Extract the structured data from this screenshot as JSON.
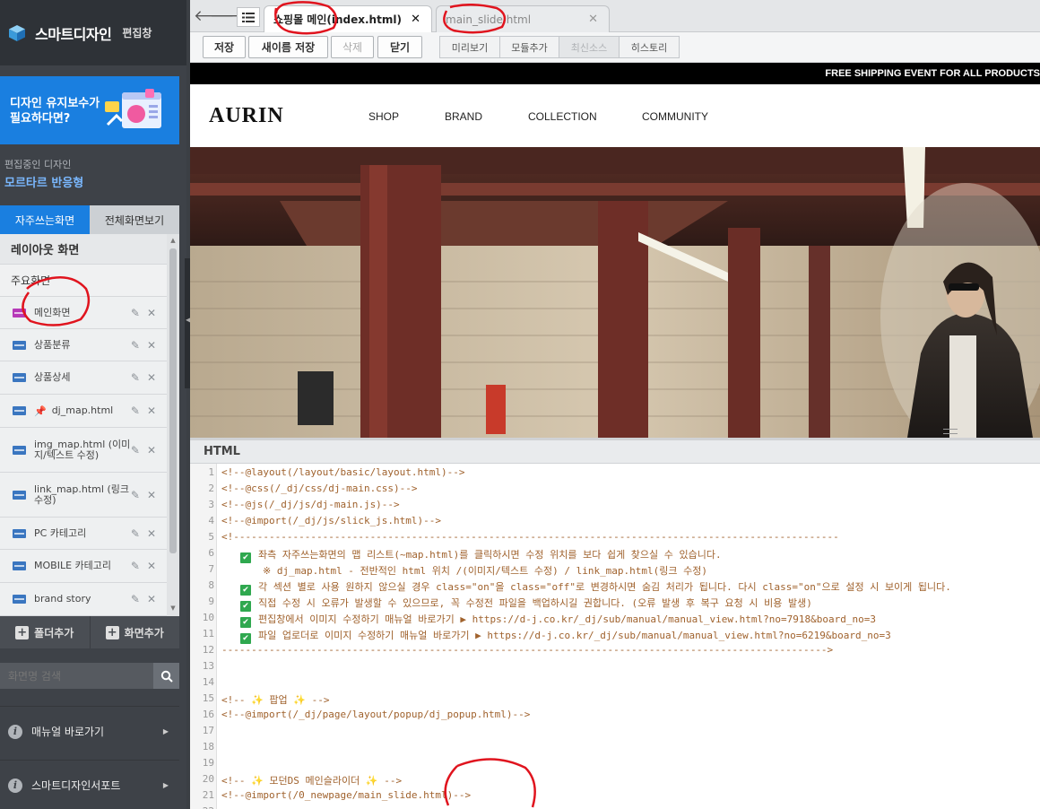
{
  "sidebar": {
    "app_title": "스마트디자인",
    "app_subtitle": "편집창",
    "banner_text": "디자인 유지보수가 필요하다면?",
    "editing_label": "편집중인 디자인",
    "editing_name": "모르타르 반응형",
    "tabs": [
      "자주쓰는화면",
      "전체화면보기"
    ],
    "layout_header": "레이아웃 화면",
    "main_header": "주요화면",
    "items": [
      {
        "label": "메인화면",
        "icon": "page-icon-highlight"
      },
      {
        "label": "상품분류",
        "icon": "page-icon"
      },
      {
        "label": "상품상세",
        "icon": "page-icon"
      },
      {
        "label": "dj_map.html",
        "icon": "page-icon",
        "pinned": true
      },
      {
        "label": "img_map.html (이미지/텍스트 수정)",
        "icon": "page-icon"
      },
      {
        "label": "link_map.html (링크 수정)",
        "icon": "page-icon"
      },
      {
        "label": "PC 카테고리",
        "icon": "page-icon"
      },
      {
        "label": "MOBILE 카테고리",
        "icon": "page-icon"
      },
      {
        "label": "brand story",
        "icon": "page-icon"
      }
    ],
    "add_folder": "폴더추가",
    "add_screen": "화면추가",
    "search_placeholder": "화면명 검색",
    "links": [
      "매뉴얼 바로가기",
      "스마트디자인서포트"
    ]
  },
  "editor": {
    "file_tabs": [
      {
        "label": "쇼핑몰 메인(index.html)",
        "active": true
      },
      {
        "label": "main_slide.html",
        "active": false
      }
    ],
    "toolbar_buttons": [
      "저장",
      "새이름 저장",
      "삭제",
      "닫기"
    ],
    "toolbar_group": [
      "미리보기",
      "모듈추가",
      "최신소스",
      "히스토리"
    ],
    "html_panel_title": "HTML",
    "code_lines": [
      "<!--@layout(/layout/basic/layout.html)-->",
      "<!--@css(/_dj/css/dj-main.css)-->",
      "<!--@js(/_dj/js/dj-main.js)-->",
      "<!--@import(/_dj/js/slick_js.html)-->",
      "<!------------------------------------------------------------------------------------------------------",
      "좌측 자주쓰는화면의 맵 리스트(~map.html)를 클릭하시면 수정 위치를 보다 쉽게 찾으실 수 있습니다.",
      "※ dj_map.html - 전반적인 html 위치 /(이미지/텍스트 수정) / link_map.html(링크 수정)",
      "각 섹션 별로 사용 원하지 않으실 경우 class=\"on\"을 class=\"off\"로 변경하시면 숨김 처리가 됩니다. 다시 class=\"on\"으로 설정 시 보이게 됩니다.",
      "직접 수정 시 오류가 발생할 수 있으므로, 꼭 수정전 파일을 백업하시길 권합니다. (오류 발생 후 복구 요청 시 비용 발생)",
      "편집창에서 이미지 수정하기 매뉴얼 바로가기 ▶ https://d-j.co.kr/_dj/sub/manual/manual_view.html?no=7918&board_no=3",
      "파일 업로더로 이미지 수정하기 매뉴얼 바로가기 ▶ https://d-j.co.kr/_dj/sub/manual/manual_view.html?no=6219&board_no=3",
      "------------------------------------------------------------------------------------------------------>",
      "",
      "",
      "<!-- ✨ 팝업 ✨ -->",
      "<!--@import(/_dj/page/layout/popup/dj_popup.html)-->",
      "",
      "",
      "",
      "<!-- ✨ 모던DS 메인슬라이더 ✨ -->",
      "<!--@import(/0_newpage/main_slide.html)-->"
    ],
    "line_numbers": [
      "1",
      "2",
      "3",
      "4",
      "5",
      "6",
      "7",
      "8",
      "9",
      "10",
      "11",
      "12",
      "13",
      "14",
      "15",
      "16",
      "17",
      "18",
      "19",
      "20",
      "21",
      "22"
    ]
  },
  "preview": {
    "promo_text": "FREE SHIPPING EVENT FOR ALL PRODUCTS",
    "logo": "AURIN",
    "nav": [
      "SHOP",
      "BRAND",
      "COLLECTION",
      "COMMUNITY"
    ]
  },
  "colors": {
    "sidebar_bg": "#3e4248",
    "accent_blue": "#1a7fe0",
    "code_text": "#a0622d",
    "check_green": "#2fa84f",
    "annotation_red": "#e0141e"
  }
}
